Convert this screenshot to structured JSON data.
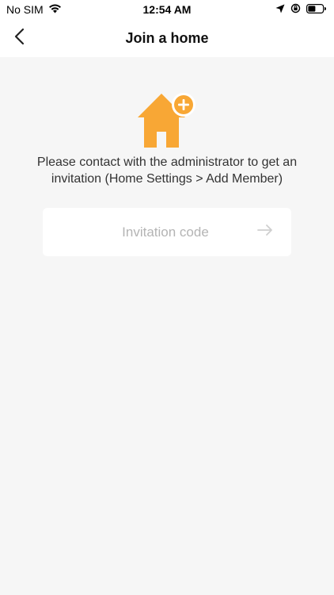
{
  "status_bar": {
    "carrier": "No SIM",
    "time": "12:54 AM"
  },
  "nav": {
    "title": "Join a home"
  },
  "content": {
    "message": "Please contact with the administrator to get an invitation (Home Settings > Add Member)",
    "code_input": {
      "value": "",
      "placeholder": "Invitation code"
    }
  },
  "colors": {
    "accent": "#f8a735",
    "background": "#f6f6f6",
    "placeholder": "#b4b4b4"
  },
  "icons": [
    "wifi-icon",
    "location-arrow-icon",
    "orientation-lock-icon",
    "battery-icon",
    "back-chevron-icon",
    "home-add-icon",
    "arrow-right-icon"
  ]
}
